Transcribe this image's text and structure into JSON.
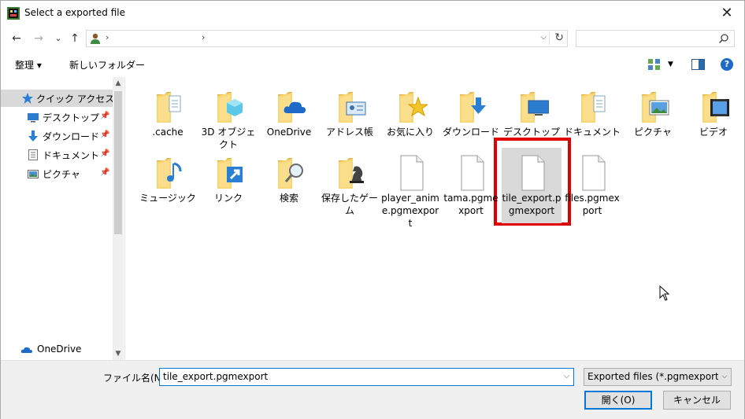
{
  "window": {
    "title": "Select a exported file",
    "close_glyph": "✕"
  },
  "nav": {
    "back_glyph": "←",
    "forward_glyph": "→",
    "recent_glyph": "⌄",
    "up_glyph": "↑",
    "address": {
      "separator": "›",
      "dropdown_glyph": "⌵",
      "refresh_glyph": "↻"
    },
    "search": {
      "placeholder": ""
    }
  },
  "toolbar": {
    "organize_label": "整理 ▾",
    "new_folder_label": "新しいフォルダー",
    "help_label": "?"
  },
  "sidebar": {
    "items": [
      {
        "label": "クイック アクセス",
        "icon": "star-icon",
        "pinned": false
      },
      {
        "label": "デスクトップ",
        "icon": "desktop-icon",
        "pinned": true
      },
      {
        "label": "ダウンロード",
        "icon": "download-icon",
        "pinned": true
      },
      {
        "label": "ドキュメント",
        "icon": "document-icon",
        "pinned": true
      },
      {
        "label": "ピクチャ",
        "icon": "pictures-icon",
        "pinned": true
      },
      {
        "label": "OneDrive",
        "icon": "onedrive-icon",
        "pinned": false
      }
    ],
    "pin_glyph": "📌",
    "scroll_up": "▲",
    "scroll_down": "▼"
  },
  "files": [
    {
      "label": ".cache",
      "type": "folder",
      "overlay": "document"
    },
    {
      "label": "3D オブジェクト",
      "type": "folder",
      "overlay": "cube"
    },
    {
      "label": "OneDrive",
      "type": "folder",
      "overlay": "cloud"
    },
    {
      "label": "アドレス帳",
      "type": "folder",
      "overlay": "card"
    },
    {
      "label": "お気に入り",
      "type": "folder",
      "overlay": "star"
    },
    {
      "label": "ダウンロード",
      "type": "folder",
      "overlay": "download"
    },
    {
      "label": "デスクトップ",
      "type": "folder",
      "overlay": "desktop"
    },
    {
      "label": "ドキュメント",
      "type": "folder",
      "overlay": "document"
    },
    {
      "label": "ピクチャ",
      "type": "folder",
      "overlay": "picture"
    },
    {
      "label": "ビデオ",
      "type": "folder",
      "overlay": "video"
    },
    {
      "label": "ミュージック",
      "type": "folder",
      "overlay": "music"
    },
    {
      "label": "リンク",
      "type": "folder",
      "overlay": "link"
    },
    {
      "label": "検索",
      "type": "folder",
      "overlay": "search"
    },
    {
      "label": "保存したゲーム",
      "type": "folder",
      "overlay": "chess"
    },
    {
      "label": "player_anime.pgmexport",
      "type": "file"
    },
    {
      "label": "tama.pgmexport",
      "type": "file"
    },
    {
      "label": "tile_export.pgmexport",
      "type": "file",
      "selected": true
    },
    {
      "label": "files.pgmexport",
      "type": "file"
    }
  ],
  "bottom": {
    "filename_label": "ファイル名(N):",
    "filename_value": "tile_export.pgmexport",
    "filter_value": "Exported files (*.pgmexport *.ag",
    "dropdown_glyph": "⌵",
    "open_label": "開く(O)",
    "cancel_label": "キャンセル"
  },
  "colors": {
    "accent": "#0078d7",
    "highlight": "#e00000",
    "folder": "#f7d774"
  }
}
